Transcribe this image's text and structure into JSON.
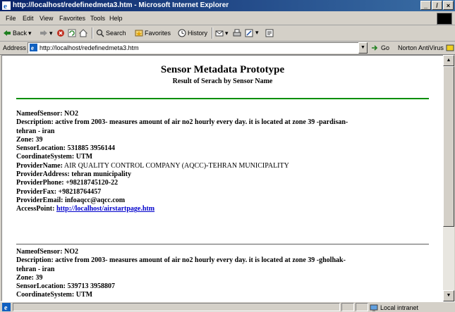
{
  "window": {
    "title": "http://localhost/redefinedmeta3.htm - Microsoft Internet Explorer",
    "min": "_",
    "max": "̸",
    "close": "×"
  },
  "menu": [
    "File",
    "Edit",
    "View",
    "Favorites",
    "Tools",
    "Help"
  ],
  "toolbar": {
    "back": "Back",
    "search": "Search",
    "favorites": "Favorites",
    "history": "History"
  },
  "address": {
    "label": "Address",
    "url": "http://localhost/redefinedmeta3.htm",
    "go": "Go",
    "norton": "Norton AntiVirus"
  },
  "page": {
    "title": "Sensor Metadata Prototype",
    "subtitle": "Result of Serach by Sensor Name"
  },
  "records": [
    {
      "rows": [
        {
          "label": "NameofSensor:",
          "value": " NO2"
        },
        {
          "label": "Description: active from 2003- measures amount of air no2 hourly every day. it is located at zone 39 -pardisan-",
          "value": ""
        },
        {
          "label": "tehran - iran",
          "value": ""
        },
        {
          "label": "Zone:",
          "value": " 39"
        },
        {
          "label": "SensorLocation:",
          "value": " 531885 3956144"
        },
        {
          "label": "CoordinateSystem:",
          "value": " UTM"
        },
        {
          "label": "ProviderName:",
          "value": " AIR QUALITY CONTROL COMPANY (AQCC)-TEHRAN MUNICIPALITY"
        },
        {
          "label": "ProviderAddress:",
          "value": " tehran municipality"
        },
        {
          "label": "ProviderPhone:",
          "value": " +98218745120-22"
        },
        {
          "label": "ProviderFax:",
          "value": " +98218764457"
        },
        {
          "label": "ProviderEmail:",
          "value": " infoaqcc@aqcc.com"
        },
        {
          "label": "AccessPoint:",
          "value": " ",
          "link": "http://localhost/airstartpage.htm"
        }
      ]
    },
    {
      "rows": [
        {
          "label": "NameofSensor:",
          "value": " NO2"
        },
        {
          "label": "Description: active from 2003- measures amount of air no2 hourly every day. it is located at zone 39 -gholhak-",
          "value": ""
        },
        {
          "label": "tehran - iran",
          "value": ""
        },
        {
          "label": "Zone:",
          "value": " 39"
        },
        {
          "label": "SensorLocation:",
          "value": " 539713 3958807"
        },
        {
          "label": "CoordinateSystem:",
          "value": " UTM"
        }
      ]
    }
  ],
  "status": {
    "zone": "Local intranet"
  },
  "colors": {
    "title_bar": "#0a246a",
    "separator_green": "#008000",
    "link": "#0000cc"
  }
}
